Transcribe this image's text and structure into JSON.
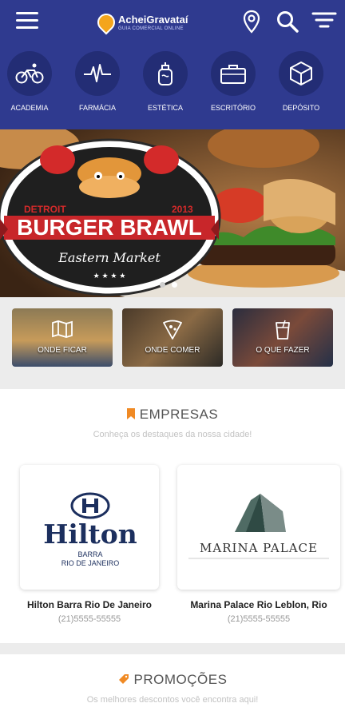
{
  "header": {
    "logo_main": "AcheiGravataí",
    "logo_sub": "GUIA COMERCIAL ONLINE",
    "categories": [
      {
        "label": "ACADEMIA",
        "icon": "bicycle-icon"
      },
      {
        "label": "FARMÁCIA",
        "icon": "heartbeat-icon"
      },
      {
        "label": "ESTÉTICA",
        "icon": "skincare-icon"
      },
      {
        "label": "ESCRITÓRIO",
        "icon": "briefcase-icon"
      },
      {
        "label": "DEPÓSITO",
        "icon": "box-icon"
      }
    ]
  },
  "banner": {
    "top_left": "DETROIT",
    "top_right": "2013",
    "title": "BURGER BRAWL",
    "subtitle": "Eastern Market",
    "active_slide": 2,
    "slide_count": 2
  },
  "quick_links": [
    {
      "label": "ONDE FICAR",
      "icon": "map-icon"
    },
    {
      "label": "ONDE COMER",
      "icon": "pizza-icon"
    },
    {
      "label": "O QUE FAZER",
      "icon": "drink-icon"
    }
  ],
  "empresas": {
    "title": "EMPRESAS",
    "subtitle": "Conheça os destaques da nossa cidade!",
    "cards": [
      {
        "logo_main": "Hilton",
        "logo_sub1": "BARRA",
        "logo_sub2": "RIO DE JANEIRO",
        "name": "Hilton Barra Rio De Janeiro",
        "phone": "(21)5555-55555"
      },
      {
        "logo_main": "MARINA PALACE",
        "name": "Marina Palace Rio Leblon, Rio",
        "phone": "(21)5555-55555"
      }
    ]
  },
  "promocoes": {
    "title": "PROMOÇÕES",
    "subtitle": "Os melhores descontos você encontra aqui!"
  },
  "colors": {
    "brand": "#2f3a8f",
    "accent": "#f4a51c",
    "orange_icon": "#f08a24"
  }
}
